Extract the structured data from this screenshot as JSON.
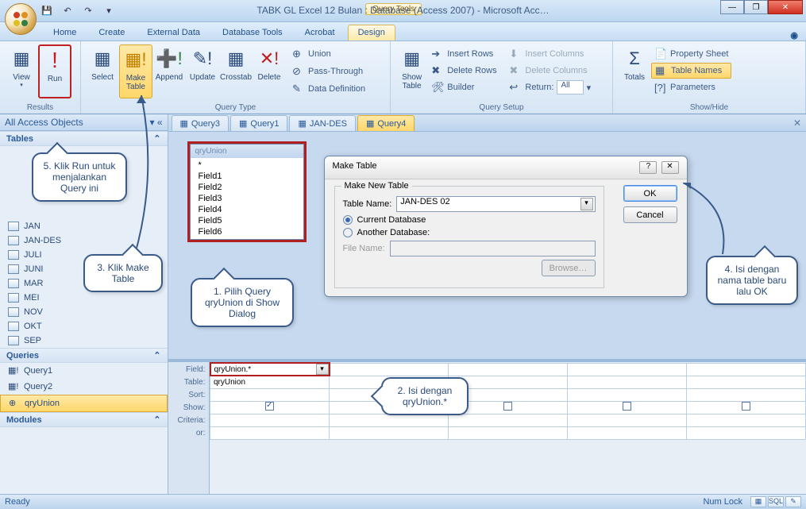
{
  "window": {
    "title": "TABK GL Excel 12 Bulan : Database (Access 2007) - Microsoft Acc…",
    "query_tools_label": "Query Tools"
  },
  "tabs": {
    "home": "Home",
    "create": "Create",
    "external": "External Data",
    "dbtools": "Database Tools",
    "acrobat": "Acrobat",
    "design": "Design"
  },
  "ribbon": {
    "results": {
      "view": "View",
      "run": "Run",
      "group": "Results"
    },
    "qtype": {
      "select": "Select",
      "make_table": "Make\nTable",
      "append": "Append",
      "update": "Update",
      "crosstab": "Crosstab",
      "delete": "Delete",
      "union": "Union",
      "passthrough": "Pass-Through",
      "datadef": "Data Definition",
      "group": "Query Type"
    },
    "setup": {
      "show_table": "Show\nTable",
      "insert_rows": "Insert Rows",
      "delete_rows": "Delete Rows",
      "builder": "Builder",
      "insert_cols": "Insert Columns",
      "delete_cols": "Delete Columns",
      "return": "Return:",
      "return_val": "All",
      "group": "Query Setup"
    },
    "showhide": {
      "totals": "Totals",
      "property": "Property Sheet",
      "table_names": "Table Names",
      "parameters": "Parameters",
      "group": "Show/Hide"
    }
  },
  "nav": {
    "header": "All Access Objects",
    "tables_hdr": "Tables",
    "tables": [
      "JAN",
      "JAN-DES",
      "JULI",
      "JUNI",
      "MAR",
      "MEI",
      "NOV",
      "OKT",
      "SEP"
    ],
    "queries_hdr": "Queries",
    "queries": [
      "Query1",
      "Query2",
      "qryUnion"
    ],
    "modules_hdr": "Modules"
  },
  "doc_tabs": [
    "Query3",
    "Query1",
    "JAN-DES",
    "Query4"
  ],
  "table_card": {
    "title": "qryUnion",
    "fields": [
      "*",
      "Field1",
      "Field2",
      "Field3",
      "Field4",
      "Field5",
      "Field6"
    ]
  },
  "dialog": {
    "title": "Make Table",
    "legend": "Make New Table",
    "table_name_lbl": "Table Name:",
    "table_name_val": "JAN-DES 02",
    "current_db": "Current Database",
    "another_db": "Another Database:",
    "file_name_lbl": "File Name:",
    "browse": "Browse…",
    "ok": "OK",
    "cancel": "Cancel"
  },
  "grid": {
    "labels": [
      "Field:",
      "Table:",
      "Sort:",
      "Show:",
      "Criteria:",
      "or:"
    ],
    "field_val": "qryUnion.*",
    "table_val": "qryUnion"
  },
  "status": {
    "ready": "Ready",
    "numlock": "Num Lock"
  },
  "callouts": {
    "c1": "5. Klik Run untuk menjalankan Query ini",
    "c2": "1. Pilih Query qryUnion di Show Dialog",
    "c3": "3. Klik Make Table",
    "c4": "2. Isi dengan qryUnion.*",
    "c5": "4. Isi dengan nama table baru lalu OK"
  }
}
